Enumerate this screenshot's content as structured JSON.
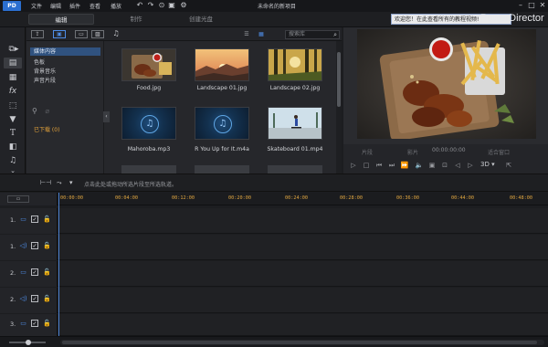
{
  "titlebar": {
    "menus": [
      "文件",
      "编辑",
      "插件",
      "查看",
      "播放"
    ],
    "project_title": "未命名的新项目",
    "notice": "欢迎您！在此查看所有的教程视频!",
    "brand": "PowerDirector"
  },
  "modes": {
    "edit": "编辑",
    "produce": "制作",
    "create_disc": "创建光盘"
  },
  "library": {
    "search_placeholder": "搜索库",
    "categories": [
      "媒体内容",
      "色板",
      "背景音乐",
      "声音片段"
    ],
    "downloaded": "已下载  (0)",
    "items": [
      {
        "label": "Food.jpg",
        "kind": "image"
      },
      {
        "label": "Landscape 01.jpg",
        "kind": "image"
      },
      {
        "label": "Landscape 02.jpg",
        "kind": "image"
      },
      {
        "label": "Mahoroba.mp3",
        "kind": "audio"
      },
      {
        "label": "R You Up for It.m4a",
        "kind": "audio"
      },
      {
        "label": "Skateboard 01.mp4",
        "kind": "video"
      }
    ]
  },
  "preview": {
    "clip_label": "片段",
    "movie_label": "影片",
    "timecode": "00:00:00:00",
    "fit_label": "适合窗口",
    "mode_3d": "3D"
  },
  "timeline": {
    "hint": "点击此处或拖动所选片段至所选轨道。",
    "ruler_ticks": [
      "00:00:00",
      "00:04:00",
      "00:08:00",
      "00:12:00",
      "00:16:00",
      "00:20:00",
      "00:24:00",
      "00:28:00",
      "00:32:00",
      "00:36:00",
      "00:40:00",
      "00:44:00",
      "00:48:00"
    ],
    "tracks": [
      {
        "num": "1.",
        "type": "video"
      },
      {
        "num": "1.",
        "type": "audio"
      },
      {
        "num": "2.",
        "type": "video"
      },
      {
        "num": "2.",
        "type": "audio"
      },
      {
        "num": "3.",
        "type": "video"
      }
    ]
  }
}
